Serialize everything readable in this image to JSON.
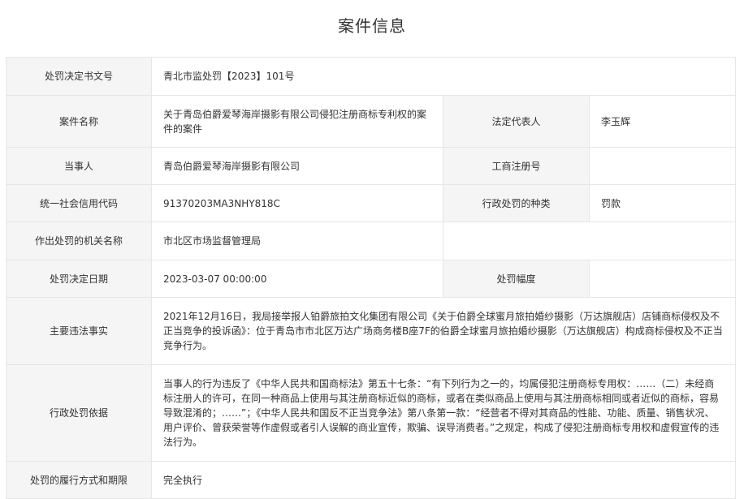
{
  "page": {
    "title": "案件信息"
  },
  "rows": {
    "decision_no": {
      "label": "处罚决定书文号",
      "value": "青北市监处罚【2023】101号"
    },
    "case_name": {
      "label": "案件名称",
      "value": "关于青岛伯爵爱琴海岸摄影有限公司侵犯注册商标专利权的案件的案件"
    },
    "legal_rep": {
      "label": "法定代表人",
      "value": "李玉辉"
    },
    "party": {
      "label": "当事人",
      "value": "青岛伯爵爱琴海岸摄影有限公司"
    },
    "reg_no": {
      "label": "工商注册号",
      "value": ""
    },
    "credit_code": {
      "label": "统一社会信用代码",
      "value": "91370203MA3NHY818C"
    },
    "penalty_type": {
      "label": "行政处罚的种类",
      "value": "罚款"
    },
    "authority": {
      "label": "作出处罚的机关名称",
      "value": "市北区市场监督管理局"
    },
    "decision_date": {
      "label": "处罚决定日期",
      "value": "2023-03-07 00:00:00"
    },
    "penalty_range": {
      "label": "处罚幅度",
      "value": ""
    },
    "facts": {
      "label": "主要违法事实",
      "value": "2021年12月16日，我局接举报人铂爵旅拍文化集团有限公司《关于伯爵全球蜜月旅拍婚纱摄影（万达旗舰店）店铺商标侵权及不正当竞争的投诉函》：位于青岛市市北区万达广场商务楼B座7F的伯爵全球蜜月旅拍婚纱摄影（万达旗舰店）构成商标侵权及不正当竞争行为。"
    },
    "basis": {
      "label": "行政处罚依据",
      "value": "当事人的行为违反了《中华人民共和国商标法》第五十七条：“有下列行为之一的，均属侵犯注册商标专用权：……（二）未经商标注册人的许可，在同一种商品上使用与其注册商标近似的商标，或者在类似商品上使用与其注册商标相同或者近似的商标，容易导致混淆的；……”；《中华人民共和国反不正当竞争法》第八条第一款：“经营者不得对其商品的性能、功能、质量、销售状况、用户评价、曾获荣誉等作虚假或者引人误解的商业宣传，欺骗、误导消费者。”之规定，构成了侵犯注册商标专用权和虚假宣传的违法行为。"
    },
    "execution": {
      "label": "处罚的履行方式和期限",
      "value": "完全执行"
    }
  }
}
